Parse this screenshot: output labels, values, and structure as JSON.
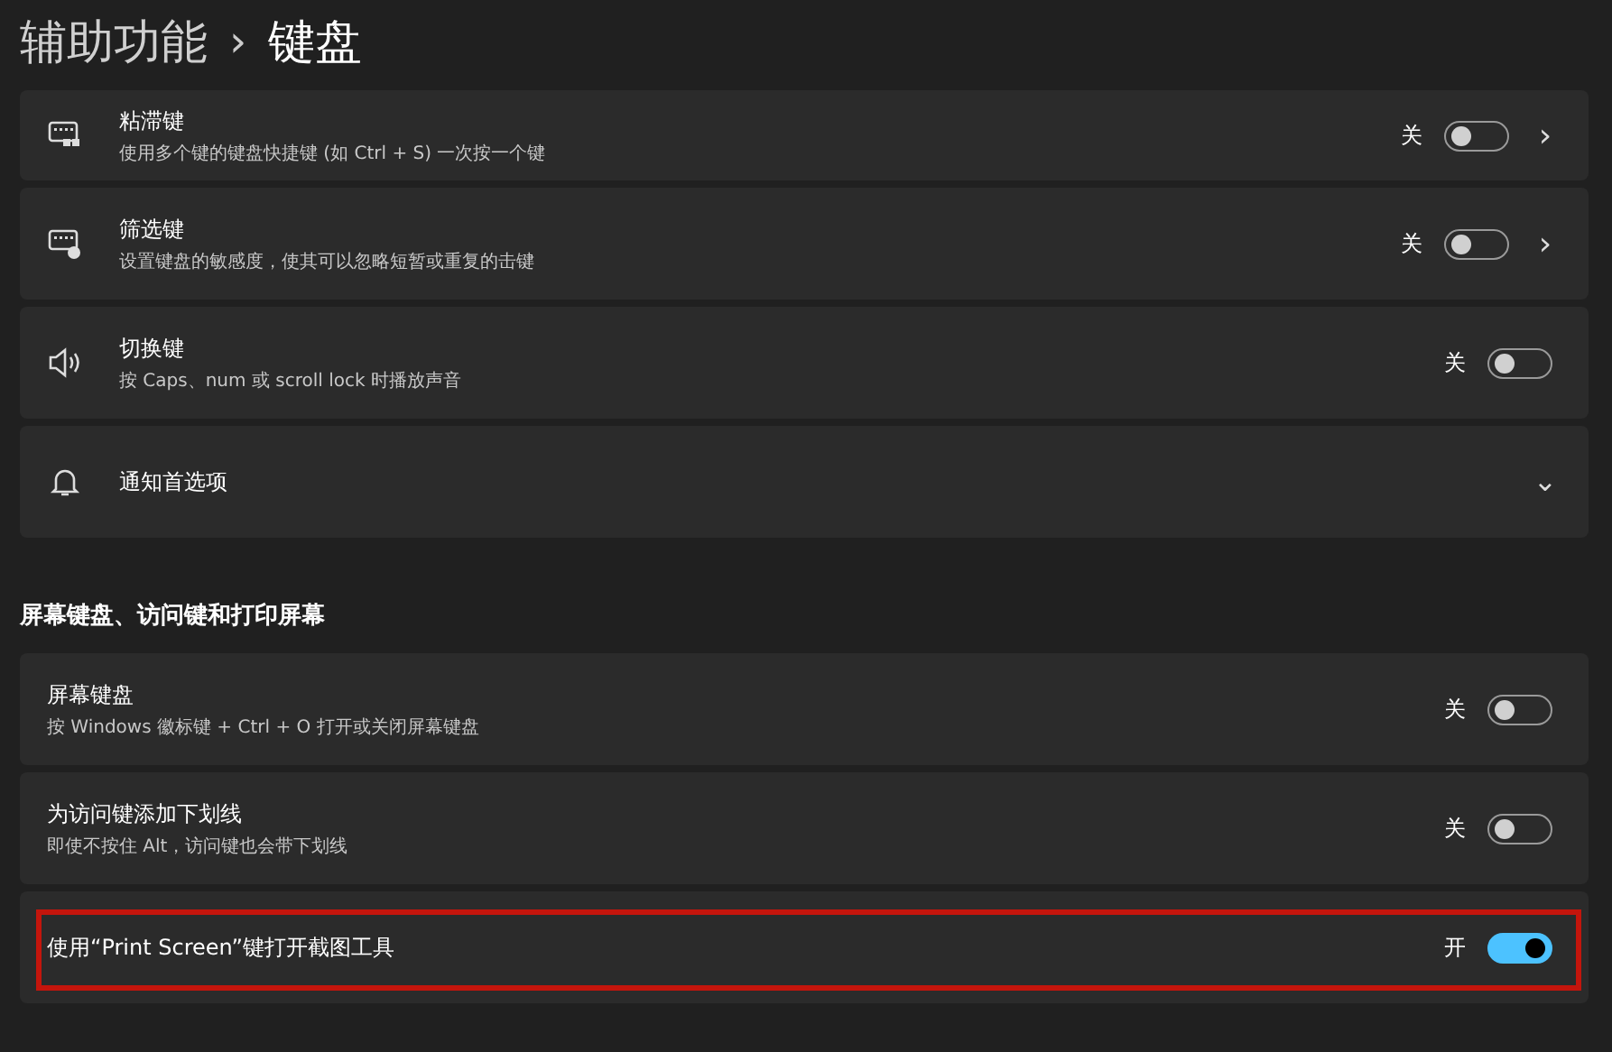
{
  "breadcrumb": {
    "parent": "辅助功能",
    "separator": "›",
    "current": "键盘"
  },
  "groups": [
    {
      "rows": [
        {
          "kind": "toggle",
          "title": "粘滞键",
          "description": "使用多个键的键盘快捷键 (如 Ctrl + S) 一次按一个键",
          "state_text": "关",
          "on": false,
          "chevron": "›",
          "highlighted": false
        },
        {
          "kind": "toggle",
          "title": "筛选键",
          "description": "设置键盘的敏感度，使其可以忽略短暂或重复的击键",
          "state_text": "关",
          "on": false,
          "chevron": "›",
          "highlighted": false
        },
        {
          "kind": "toggle",
          "title": "切换键",
          "description": "按 Caps、num 或 scroll lock 时播放声音",
          "state_text": "关",
          "on": false,
          "highlighted": false
        },
        {
          "kind": "expand",
          "title": "通知首选项",
          "chevron": "⌄",
          "highlighted": false
        }
      ]
    },
    {
      "heading": "屏幕键盘、访问键和打印屏幕",
      "rows": [
        {
          "kind": "toggle",
          "title": "屏幕键盘",
          "description": "按 Windows 徽标键 + Ctrl + O 打开或关闭屏幕键盘",
          "state_text": "关",
          "on": false,
          "highlighted": false
        },
        {
          "kind": "toggle",
          "title": "为访问键添加下划线",
          "description": "即使不按住 Alt，访问键也会带下划线",
          "state_text": "关",
          "on": false,
          "highlighted": false
        },
        {
          "kind": "toggle",
          "title": "使用“Print Screen”键打开截图工具",
          "state_text": "开",
          "on": true,
          "highlighted": true
        }
      ]
    }
  ]
}
